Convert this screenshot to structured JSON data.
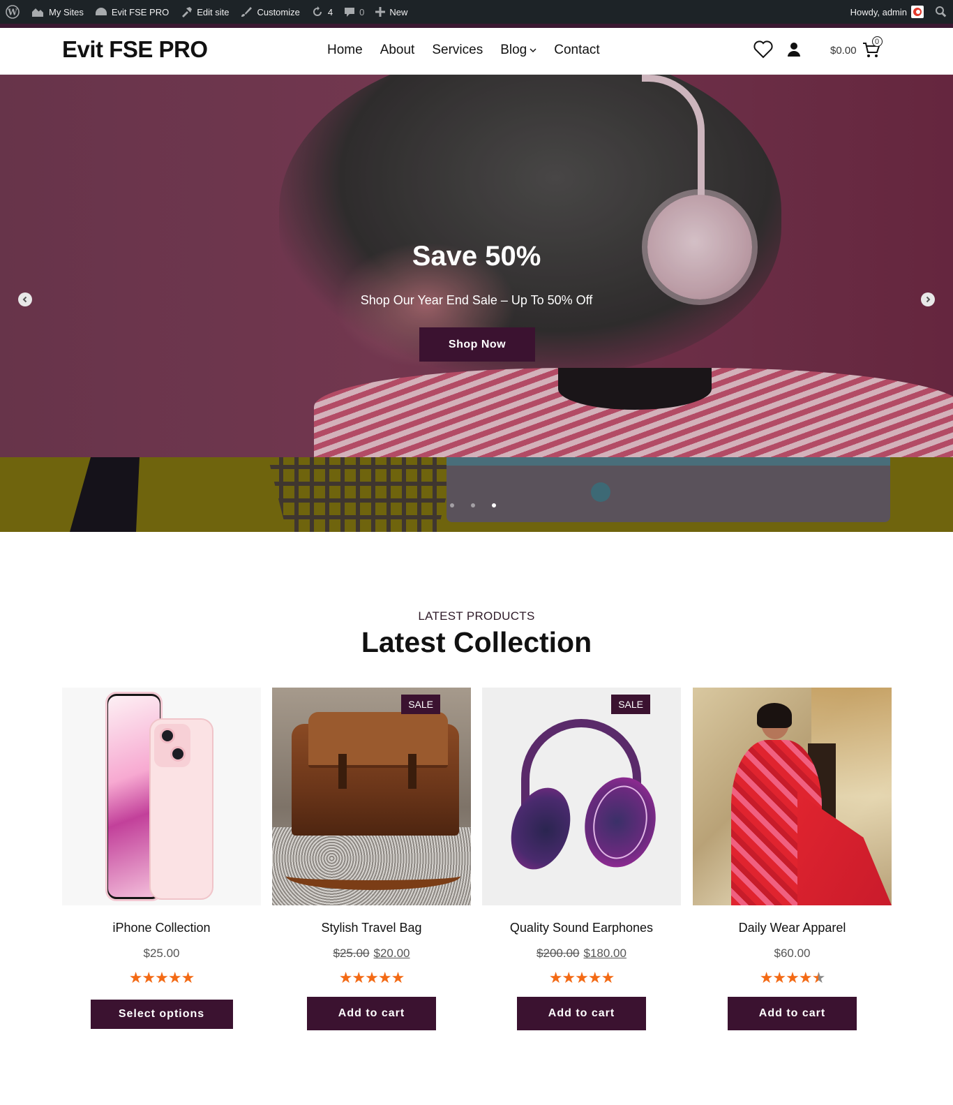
{
  "adminbar": {
    "my_sites": "My Sites",
    "site_name": "Evit FSE PRO",
    "edit_site": "Edit site",
    "customize": "Customize",
    "updates": "4",
    "comments": "0",
    "new": "New",
    "howdy": "Howdy, admin"
  },
  "header": {
    "logo": "Evit FSE PRO",
    "nav": [
      "Home",
      "About",
      "Services",
      "Blog",
      "Contact"
    ],
    "cart_total": "$0.00",
    "cart_count": "0"
  },
  "hero": {
    "title": "Save 50%",
    "subtitle": "Shop Our Year End Sale – Up To 50% Off",
    "button": "Shop Now",
    "slides": 3,
    "active_slide": 3
  },
  "products": {
    "eyebrow": "LATEST PRODUCTS",
    "title": "Latest Collection",
    "items": [
      {
        "name": "iPhone Collection",
        "price": "$25.00",
        "old_price": "",
        "sale": "",
        "rating": 5,
        "button": "Select options"
      },
      {
        "name": "Stylish Travel Bag",
        "price": "$20.00",
        "old_price": "$25.00",
        "sale": "SALE",
        "rating": 5,
        "button": "Add to cart"
      },
      {
        "name": "Quality Sound Earphones",
        "price": "$180.00",
        "old_price": "$200.00",
        "sale": "SALE",
        "rating": 5,
        "button": "Add to cart"
      },
      {
        "name": "Daily Wear Apparel",
        "price": "$60.00",
        "old_price": "",
        "sale": "",
        "rating": 4.5,
        "button": "Add to cart"
      }
    ]
  },
  "colors": {
    "accent": "#3b1230",
    "star": "#f36a15",
    "adminbar": "#1d2327"
  }
}
